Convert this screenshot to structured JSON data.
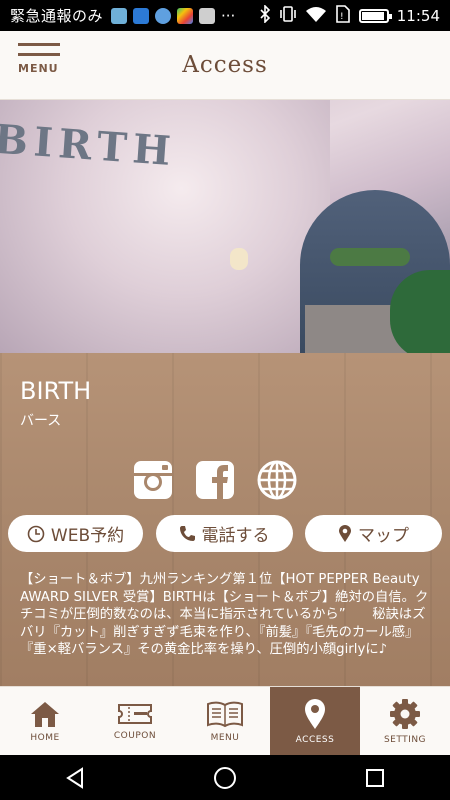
{
  "status_bar": {
    "carrier": "緊急通報のみ",
    "time": "11:54",
    "more": "···"
  },
  "header": {
    "menu_label": "MENU",
    "title": "Access"
  },
  "hero": {
    "sign_text": "BIRTH"
  },
  "shop": {
    "name": "BIRTH",
    "kana": "バース"
  },
  "actions": {
    "web_reserve": "WEB予約",
    "call": "電話する",
    "map": "マップ"
  },
  "description": "【ショート＆ボブ】九州ランキング第１位【HOT PEPPER Beauty AWARD SILVER 受賞】BIRTHは【ショート＆ボブ】絶対の自信。クチコミが圧倒的数なのは、本当に指示されているから”　　秘訣はズバリ『カット』削ぎすぎず毛束を作り、『前髪』『毛先のカール感』『重×軽バランス』その黄金比率を操り、圧倒的小顔girlyに♪",
  "tabs": [
    {
      "label": "HOME",
      "icon": "home-icon"
    },
    {
      "label": "COUPON",
      "icon": "ticket-icon"
    },
    {
      "label": "MENU",
      "icon": "book-icon"
    },
    {
      "label": "ACCESS",
      "icon": "location-pin-icon",
      "active": true
    },
    {
      "label": "SETTING",
      "icon": "gear-icon"
    }
  ],
  "colors": {
    "brand_brown": "#7c5a45",
    "header_bg": "#fbf9f6",
    "wood": "#a9876c"
  }
}
